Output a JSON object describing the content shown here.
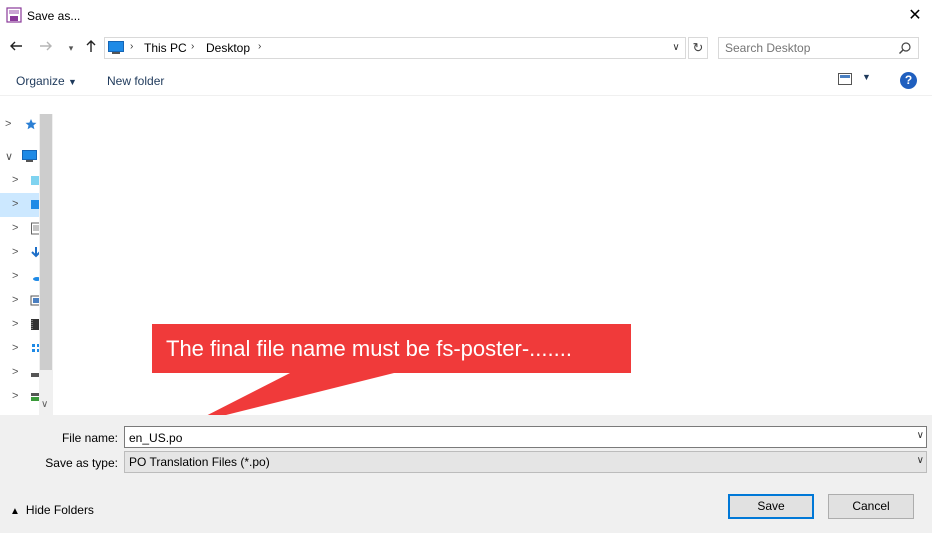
{
  "window": {
    "title": "Save as..."
  },
  "address": {
    "crumbs": [
      "This PC",
      "Desktop"
    ]
  },
  "search": {
    "placeholder": "Search Desktop"
  },
  "toolbar": {
    "organize_label": "Organize",
    "new_folder_label": "New folder",
    "help_label": "?"
  },
  "callout": {
    "text": "The final file name must be fs-poster-......."
  },
  "form": {
    "file_name_label": "File name:",
    "file_name_value": "en_US.po",
    "save_type_label": "Save as type:",
    "save_type_value": "PO Translation Files (*.po)"
  },
  "footer": {
    "hide_folders_label": "Hide Folders",
    "save_label": "Save",
    "cancel_label": "Cancel"
  },
  "colors": {
    "callout_bg": "#f03a3a",
    "accent": "#0078d7",
    "selection": "#cce8ff"
  },
  "icons": [
    "save-dialog-icon",
    "close-icon",
    "back-arrow-icon",
    "forward-arrow-icon",
    "recent-chevron-icon",
    "up-arrow-icon",
    "this-pc-icon",
    "refresh-icon",
    "search-icon",
    "view-icon",
    "help-icon",
    "quick-access-star-icon",
    "computer-icon",
    "folder-icon",
    "download-arrow-icon",
    "onedrive-icon",
    "pictures-icon",
    "video-icon",
    "network-icon",
    "drive-icon",
    "chevron-up-icon"
  ]
}
